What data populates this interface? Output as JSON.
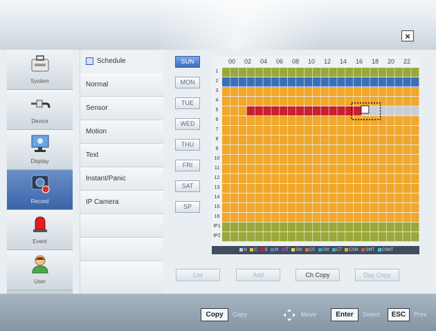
{
  "window": {
    "close_label": "×"
  },
  "nav": [
    {
      "label": "System",
      "icon": "toolbox-icon"
    },
    {
      "label": "Device",
      "icon": "cable-icon"
    },
    {
      "label": "Display",
      "icon": "monitor-icon"
    },
    {
      "label": "Record",
      "icon": "camera-record-icon",
      "active": true
    },
    {
      "label": "Event",
      "icon": "alarm-siren-icon"
    },
    {
      "label": "User",
      "icon": "user-icon"
    }
  ],
  "subnav": [
    {
      "label": "Schedule"
    },
    {
      "label": "Normal"
    },
    {
      "label": "Sensor"
    },
    {
      "label": "Motion"
    },
    {
      "label": "Text"
    },
    {
      "label": "Instant/Panic"
    },
    {
      "label": "IP Camera"
    }
  ],
  "days": [
    {
      "label": "SUN",
      "active": true
    },
    {
      "label": "MON"
    },
    {
      "label": "TUE"
    },
    {
      "label": "WED"
    },
    {
      "label": "THU"
    },
    {
      "label": "FRI"
    },
    {
      "label": "SAT"
    },
    {
      "label": "SP"
    }
  ],
  "grid": {
    "hours": [
      "00",
      "02",
      "04",
      "06",
      "08",
      "10",
      "12",
      "14",
      "16",
      "18",
      "20",
      "22"
    ],
    "rows": [
      "1",
      "2",
      "3",
      "4",
      "5",
      "6",
      "7",
      "8",
      "9",
      "10",
      "11",
      "12",
      "13",
      "14",
      "15",
      "16",
      "IP1",
      "IP2"
    ],
    "colors": {
      "olive": "#9aa83a",
      "blue": "#3a6fb8",
      "orange": "#f0a72a",
      "red": "#c8202e",
      "grey": "#c9ced3",
      "cursor": "#ffffff"
    },
    "legend": [
      {
        "code": "N",
        "color": "#c8ccd0"
      },
      {
        "code": "C",
        "color": "#f0c030"
      },
      {
        "code": "S",
        "color": "#c8202e"
      },
      {
        "code": "M",
        "color": "#4a7fd0"
      },
      {
        "code": "T",
        "color": "#8a3aa8"
      },
      {
        "code": "SM",
        "color": "#f0d040"
      },
      {
        "code": "CS",
        "color": "#e07030"
      },
      {
        "code": "CM",
        "color": "#40a0d0"
      },
      {
        "code": "CT",
        "color": "#50b0b0"
      },
      {
        "code": "CSM",
        "color": "#f0b020"
      },
      {
        "code": "SMT",
        "color": "#d06040"
      },
      {
        "code": "CSMT",
        "color": "#40c0e0"
      }
    ]
  },
  "actions": [
    {
      "label": "List",
      "enabled": false
    },
    {
      "label": "Add",
      "enabled": false
    },
    {
      "label": "Ch Copy",
      "enabled": true
    },
    {
      "label": "Day Copy",
      "enabled": false
    }
  ],
  "shortcuts": [
    {
      "key": "Copy",
      "label": "Copy"
    },
    {
      "key": "",
      "label": "Move",
      "icon": "move-arrows-icon"
    },
    {
      "key": "Enter",
      "label": "Select"
    },
    {
      "key": "ESC",
      "label": "Prev"
    }
  ]
}
